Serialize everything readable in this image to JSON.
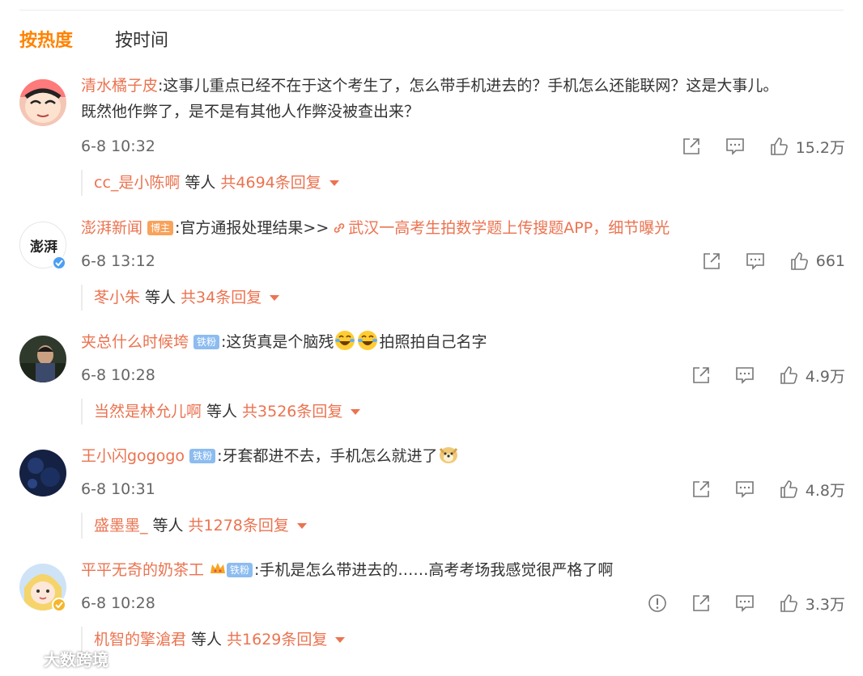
{
  "tabs": [
    {
      "label": "按热度",
      "active": true
    },
    {
      "label": "按时间",
      "active": false
    }
  ],
  "comments": [
    {
      "username": "清水橘子皮",
      "line1": ":这事儿重点已经不在于这个考生了，怎么带手机进去的？手机怎么还能联网？这是大事儿。",
      "line2": "既然他作弊了，是不是有其他人作弊没被查出来？",
      "time": "6-8 10:32",
      "likes": "15.2万",
      "reply_user": "cc_是小陈啊",
      "reply_mid": "等人",
      "reply_total": "共4694条回复"
    },
    {
      "username": "澎湃新闻",
      "badge": "博主",
      "text_prefix": ":官方通报处理结果>>",
      "link_text": "武汉一高考生拍数学题上传搜题APP，细节曝光",
      "avatar_text": "澎湃",
      "time": "6-8 13:12",
      "likes": "661",
      "reply_user": "苳小朱",
      "reply_mid": "等人",
      "reply_total": "共34条回复"
    },
    {
      "username": "夹总什么时候垮",
      "badge": "铁粉",
      "text_a": ":这货真是个脑残",
      "text_b": "拍照拍自己名字",
      "time": "6-8 10:28",
      "likes": "4.9万",
      "reply_user": "当然是林允儿啊",
      "reply_mid": "等人",
      "reply_total": "共3526条回复"
    },
    {
      "username": "王小闪gogogo",
      "badge": "铁粉",
      "text_a": ":牙套都进不去，手机怎么就进了",
      "time": "6-8 10:31",
      "likes": "4.8万",
      "reply_user": "盛墨墨_",
      "reply_mid": "等人",
      "reply_total": "共1278条回复"
    },
    {
      "username": "平平无奇的奶茶工",
      "badge": "铁粉",
      "text_a": ":手机是怎么带进去的……高考考场我感觉很严格了啊",
      "time": "6-8 10:28",
      "likes": "3.3万",
      "reply_user": "机智的擎滄君",
      "reply_mid": "等人",
      "reply_total": "共1629条回复"
    }
  ],
  "watermark": "大数跨境",
  "colors": {
    "accent": "#ff8200",
    "username": "#eb7350",
    "muted": "#666666"
  },
  "icons": [
    "share-icon",
    "comment-icon",
    "like-icon",
    "report-icon",
    "link-icon",
    "verified-icon",
    "crown-icon"
  ]
}
